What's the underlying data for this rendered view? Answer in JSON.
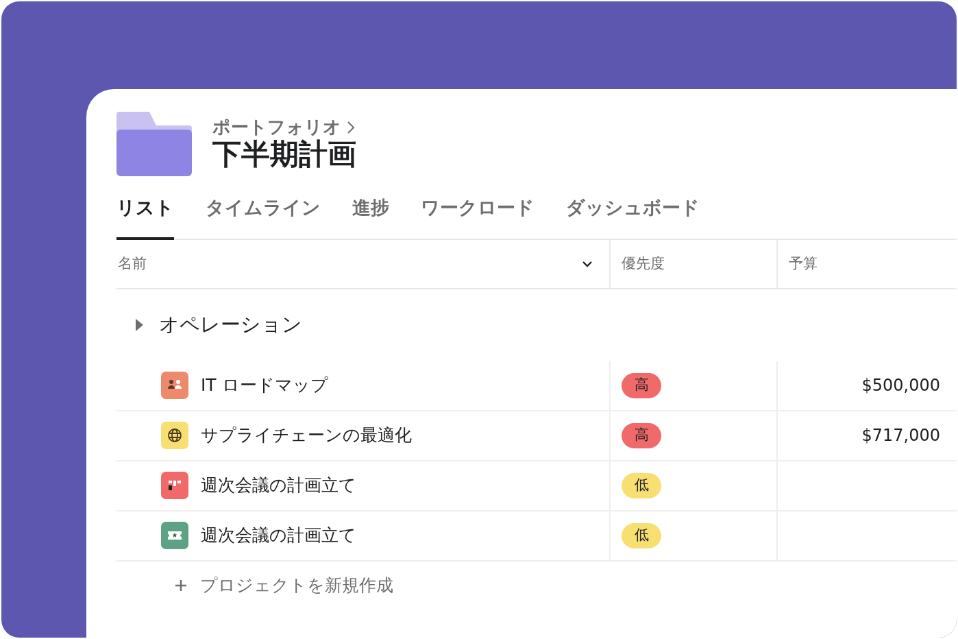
{
  "header": {
    "breadcrumb": "ポートフォリオ",
    "title": "下半期計画"
  },
  "tabs": [
    {
      "label": "リスト",
      "selected": true
    },
    {
      "label": "タイムライン",
      "selected": false
    },
    {
      "label": "進捗",
      "selected": false
    },
    {
      "label": "ワークロード",
      "selected": false
    },
    {
      "label": "ダッシュボード",
      "selected": false
    }
  ],
  "table": {
    "columns": [
      "名前",
      "優先度",
      "予算"
    ],
    "group": {
      "label": "オペレーション",
      "expanded": false
    },
    "rows": [
      {
        "name": "IT ロードマップ",
        "icon": {
          "kind": "people",
          "color": "#ee8a6c"
        },
        "priority": {
          "label": "高",
          "color": "#f06a6a"
        },
        "budget": "$500,000"
      },
      {
        "name": "サプライチェーンの最適化",
        "icon": {
          "kind": "globe",
          "color": "#f8df72"
        },
        "priority": {
          "label": "高",
          "color": "#f06a6a"
        },
        "budget": "$717,000"
      },
      {
        "name": "週次会議の計画立て",
        "icon": {
          "kind": "board",
          "color": "#f06a6a"
        },
        "priority": {
          "label": "低",
          "color": "#f8df72"
        }
      },
      {
        "name": "週次会議の計画立て",
        "icon": {
          "kind": "ticket",
          "color": "#5da283"
        },
        "priority": {
          "label": "低",
          "color": "#f8df72"
        }
      }
    ],
    "add_label": "プロジェクトを新規作成"
  }
}
